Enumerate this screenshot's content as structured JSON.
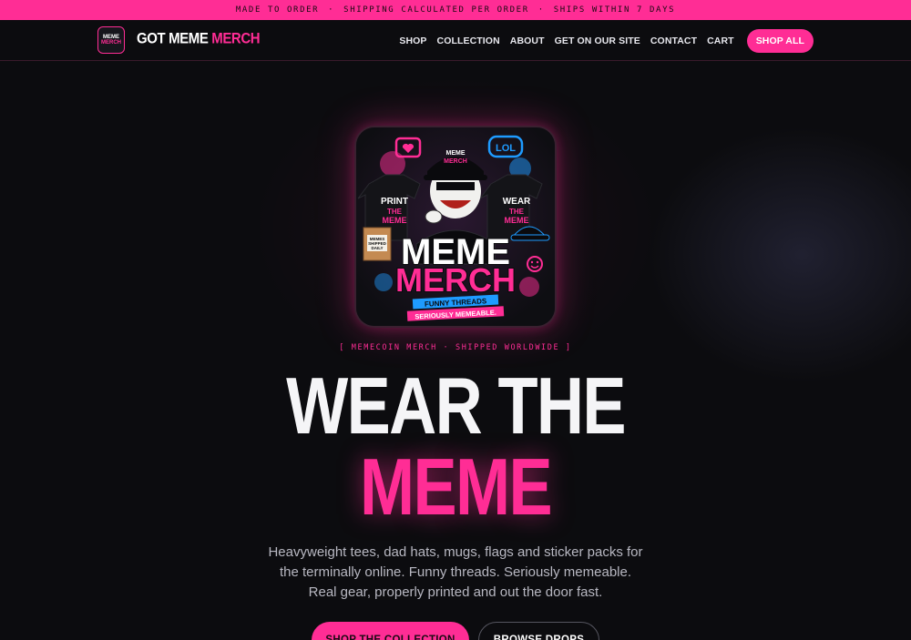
{
  "announcement": {
    "items": [
      "MADE TO ORDER",
      "SHIPPING CALCULATED PER ORDER",
      "SHIPS WITHIN 7 DAYS"
    ],
    "separator": "·"
  },
  "logo": {
    "line1": "MEME",
    "line2": "MERCH"
  },
  "brand": {
    "part1": "GOT MEME ",
    "part2": "MERCH"
  },
  "nav": {
    "items": [
      "SHOP",
      "COLLECTION",
      "ABOUT",
      "GET ON OUR SITE",
      "CONTACT",
      "CART"
    ],
    "cta": "SHOP ALL"
  },
  "hero_image": {
    "brand_hat": "MEME\nMERCH",
    "bubble": "LOL",
    "shirt_left": [
      "PRINT",
      "THE",
      "MEME"
    ],
    "shirt_right": [
      "WEAR",
      "THE",
      "MEME"
    ],
    "box": [
      "MEMES",
      "SHIPPED",
      "DAILY"
    ],
    "title_line1": "MEME",
    "title_line2": "MERCH",
    "ribbon1": "FUNNY THREADS",
    "ribbon2": "SERIOUSLY MEMEABLE."
  },
  "hero": {
    "eyebrow": "[ MEMECOIN MERCH · SHIPPED WORLDWIDE ]",
    "headline_line1": "WEAR THE",
    "headline_line2": "MEME",
    "subtitle": "Heavyweight tees, dad hats, mugs, flags and sticker packs for the terminally online. Funny threads. Seriously memeable. Real gear, properly printed and out the door fast.",
    "primary_cta": "SHOP THE COLLECTION",
    "secondary_cta": "BROWSE DROPS"
  },
  "colors": {
    "accent": "#ff2d95",
    "background": "#0c0c0f",
    "blue": "#1e9bff"
  }
}
